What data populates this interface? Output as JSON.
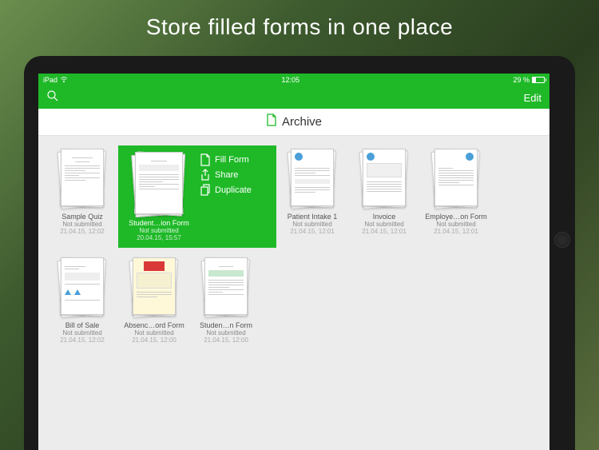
{
  "promo": {
    "headline": "Store filled forms in one place"
  },
  "statusBar": {
    "carrier": "iPad",
    "time": "12:05",
    "battery": "29 %"
  },
  "navBar": {
    "edit": "Edit"
  },
  "titleBar": {
    "title": "Archive"
  },
  "selected": {
    "name": "Student…ion Form",
    "status": "Not submitted",
    "date": "20.04.15, 15:57",
    "actions": {
      "fill": "Fill Form",
      "share": "Share",
      "duplicate": "Duplicate"
    }
  },
  "forms": {
    "row1": [
      {
        "name": "Sample Quiz",
        "status": "Not submitted",
        "date": "21.04.15, 12:02"
      },
      {
        "name": "Patient Intake 1",
        "status": "Not submitted",
        "date": "21.04.15, 12:01"
      },
      {
        "name": "Invoice",
        "status": "Not submitted",
        "date": "21.04.15, 12:01"
      },
      {
        "name": "Employe…on Form",
        "status": "Not submitted",
        "date": "21.04.15, 12:01"
      }
    ],
    "row2": [
      {
        "name": "Bill of Sale",
        "status": "Not submitted",
        "date": "21.04.15, 12:02"
      },
      {
        "name": "Absenc…ord Form",
        "status": "Not submitted",
        "date": "21.04.15, 12:00"
      },
      {
        "name": "Studen…n Form",
        "status": "Not submitted",
        "date": "21.04.15, 12:00"
      }
    ]
  }
}
